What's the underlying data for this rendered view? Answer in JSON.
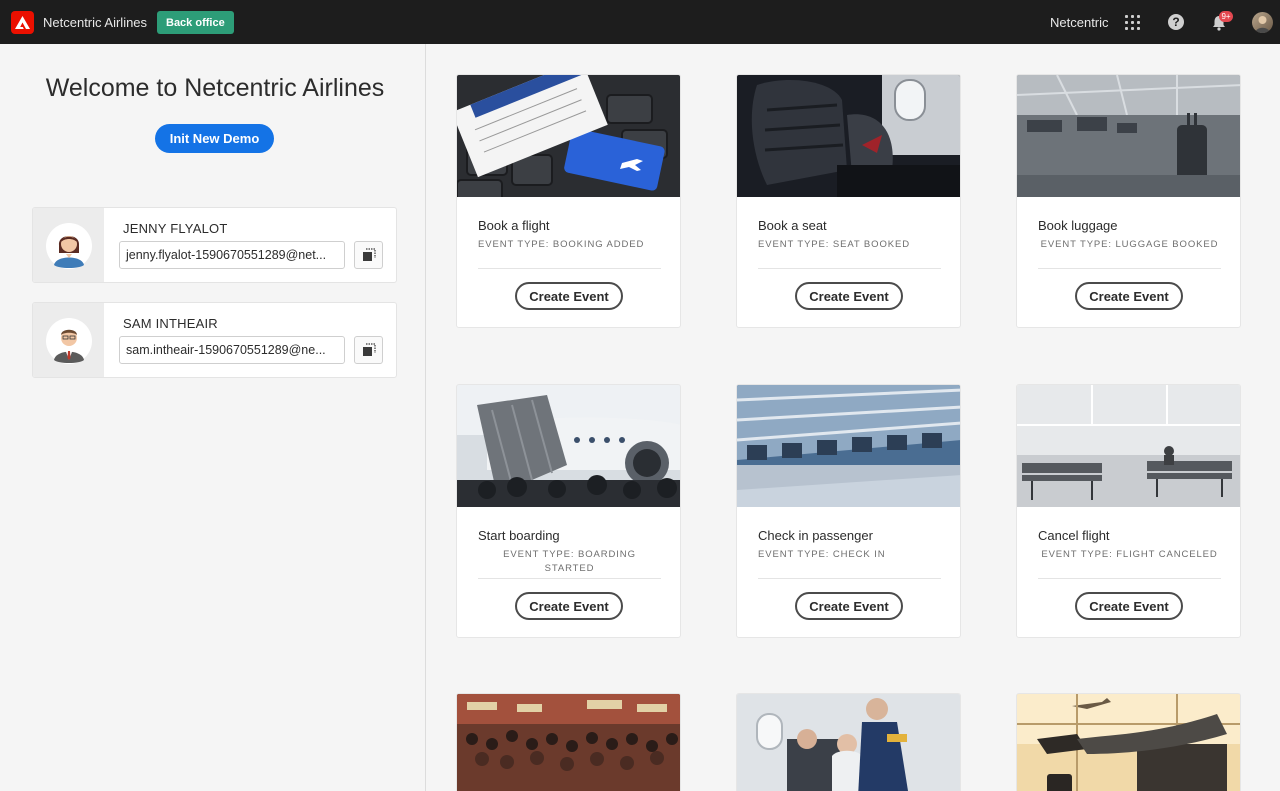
{
  "topbar": {
    "app_title": "Netcentric Airlines",
    "backoffice_label": "Back office",
    "org_name": "Netcentric",
    "notification_count": "9+"
  },
  "left": {
    "welcome": "Welcome to Netcentric Airlines",
    "init_button": "Init New Demo",
    "users": [
      {
        "name": "JENNY FLYALOT",
        "email": "jenny.flyalot-1590670551289@net..."
      },
      {
        "name": "SAM INTHEAIR",
        "email": "sam.intheair-1590670551289@ne..."
      }
    ]
  },
  "events": [
    {
      "title": "Book a flight",
      "event_type": "EVENT TYPE: BOOKING ADDED",
      "button": "Create Event"
    },
    {
      "title": "Book a seat",
      "event_type": "EVENT TYPE: SEAT BOOKED",
      "button": "Create Event"
    },
    {
      "title": "Book luggage",
      "event_type": "EVENT TYPE: LUGGAGE BOOKED",
      "button": "Create Event"
    },
    {
      "title": "Start boarding",
      "event_type": "EVENT TYPE: BOARDING STARTED",
      "button": "Create Event"
    },
    {
      "title": "Check in passenger",
      "event_type": "EVENT TYPE: CHECK IN",
      "button": "Create Event"
    },
    {
      "title": "Cancel flight",
      "event_type": "EVENT TYPE: FLIGHT CANCELED",
      "button": "Create Event"
    }
  ],
  "colors": {
    "topbar": "#1d1d1d",
    "brand_red": "#eb1000",
    "backoffice_green": "#2d9d78",
    "primary_blue": "#1473e6"
  }
}
